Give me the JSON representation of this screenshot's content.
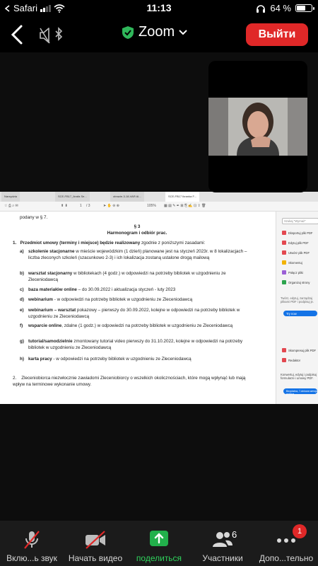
{
  "status_bar": {
    "carrier": "Safari",
    "time": "11:13",
    "battery": "64 %",
    "battery_level": 0.64
  },
  "header": {
    "title": "Zoom",
    "leave_label": "Выйти",
    "colors": {
      "leave": "#e02828",
      "shield": "#2fb75a"
    }
  },
  "shared_document": {
    "tab_labels": [
      "Narzędzia",
      "SCE-FB17_Ikrafa Se...",
      "obrazie-3-18-VAR AI...",
      "SCE-FB17 Ikranka F..."
    ],
    "page_number": "1",
    "page_total": "/ 3",
    "zoom": "105%",
    "top_line": "podany w § 7.",
    "section": "§ 3",
    "section_title": "Harmonogram i odbiór prac.",
    "point1_number": "1.",
    "point1_bold": "Przedmiot umowy (terminy i miejsce) będzie realizowany",
    "point1_text": " zgodnie z poniższymi zasadami:",
    "items": [
      {
        "letter": "a)",
        "bold": "szkolenie stacjonarne",
        "text": " w mieście wojewódzkim (1 dzień) planowane jest na styczeń 2023r. w 8 lokalizacjach – liczba zleconych szkoleń (szacunkowo 2-3) i ich lokalizacja zostaną ustalone drogą mailową"
      },
      {
        "letter": "b)",
        "bold": "warsztat stacjonarny",
        "text": " w bibliotekach (4 godz.)     w odpowiedzi na potrzeby bibliotek w uzgodnieniu ze Zleceniodawcą"
      },
      {
        "letter": "c)",
        "bold": "baza materiałów online",
        "text": " – do 30.09.2022 i aktualizacja  styczeń - luty 2023"
      },
      {
        "letter": "d)",
        "bold": "webinarium",
        "text": "  - w odpowiedzi na potrzeby bibliotek w uzgodnieniu ze Zleceniodawcą"
      },
      {
        "letter": "e)",
        "bold": "webinarium – warsztat",
        "text": " pokazowy – pierwszy do 30.09.2022, kolejne w odpowiedzi na potrzeby bibliotek w uzgodnieniu ze Zleceniodawcą"
      },
      {
        "letter": "f)",
        "bold": "wsparcie online",
        "text": ", zdalne (1 godz.)    w odpowiedzi na potrzeby bibliotek w uzgodnieniu ze Zleceniodawcą"
      },
      {
        "letter": "g)",
        "bold": "tutorial/samodzielnie",
        "text": " zmontowany tutorial video  pierwszy do 31.10.2022, kolejne w odpowiedzi na potrzeby bibliotek w uzgodnieniu ze Zleceniodawcą"
      },
      {
        "letter": "h)",
        "bold": "karta pracy",
        "text": " - w odpowiedzi na potrzeby bibliotek w uzgodnieniu ze Zleceniodawcą"
      }
    ],
    "point2_number": "2.",
    "point2_text": "Zleceniobiorca niezwłocznie zawiadomi Zleceniobiorcy o wszelkich okolicznościach, które mogą wpłynąć lub mają wpływ na terminowe wykonanie umowy.",
    "side_panel": {
      "search_placeholder": "Szukaj \"Wymaż\"",
      "tools": [
        {
          "label": "Eksportuj plik PDF",
          "color": "#e34850"
        },
        {
          "label": "Edytuj plik PDF",
          "color": "#e34850"
        },
        {
          "label": "Utwórz plik PDF",
          "color": "#e34850"
        },
        {
          "label": "Skomentuj",
          "color": "#f2b300"
        },
        {
          "label": "Połącz pliki",
          "color": "#9b5fd6"
        },
        {
          "label": "Organizuj strony",
          "color": "#2da44e"
        }
      ],
      "promo_text": "Twórz, edytuj, zarządzaj plikami PDF i podpisuj je.",
      "promo_button": "Try now",
      "tools2": [
        {
          "label": "Skompresuj plik PDF",
          "color": "#e34850"
        },
        {
          "label": "Redaktor",
          "color": "#e34850"
        }
      ],
      "promo2_text": "Konwertuj, edytuj i podpisuj formularze i umowy PDF.",
      "promo2_button": "Bezpłatna, 7-dniowa wersja próbna"
    }
  },
  "toolbar": {
    "mute_label": "Вклю...ь звук",
    "video_label": "Начать видео",
    "share_label": "поделиться",
    "participants_label": "Участники",
    "participants_count": "6",
    "more_label": "Допо...тельно",
    "more_badge": "1",
    "colors": {
      "share": "#22b04b",
      "share_label": "#2fd35c",
      "badge": "#e02828",
      "strike": "#e02828"
    }
  }
}
